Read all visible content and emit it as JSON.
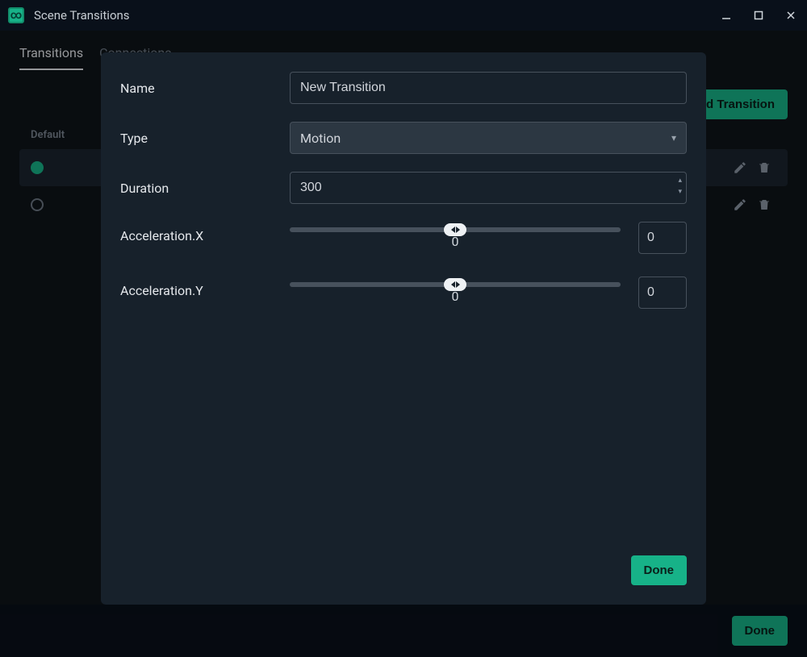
{
  "window": {
    "title": "Scene Transitions"
  },
  "tabs": {
    "transitions": "Transitions",
    "connections": "Connections",
    "active": "transitions"
  },
  "toolbar": {
    "add_button": "Add Transition"
  },
  "section": {
    "default_label": "Default"
  },
  "list": {
    "rows": [
      {
        "label": "",
        "active": true
      },
      {
        "label": "",
        "active": false
      }
    ]
  },
  "bottom": {
    "done": "Done"
  },
  "modal": {
    "fields": {
      "name_label": "Name",
      "name_value": "New Transition",
      "type_label": "Type",
      "type_value": "Motion",
      "duration_label": "Duration",
      "duration_value": "300",
      "accel_x_label": "Acceleration.X",
      "accel_x_value": "0",
      "accel_x_num": "0",
      "accel_y_label": "Acceleration.Y",
      "accel_y_value": "0",
      "accel_y_num": "0"
    },
    "done": "Done"
  },
  "colors": {
    "accent": "#17b288",
    "panel": "#17212b",
    "bg": "#0e1419"
  }
}
